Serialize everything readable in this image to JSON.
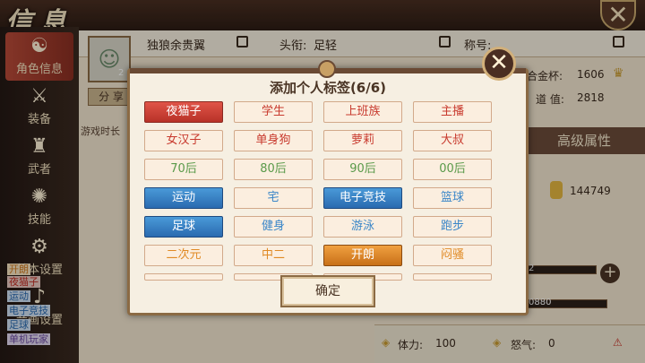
{
  "header": {
    "title": "信息",
    "close_icon": "close-icon"
  },
  "sidebar": {
    "items": [
      {
        "label": "角色信息",
        "icon": "character-icon"
      },
      {
        "label": "装备",
        "icon": "swords-icon"
      },
      {
        "label": "武者",
        "icon": "warrior-icon"
      },
      {
        "label": "技能",
        "icon": "skill-icon"
      },
      {
        "label": "基本设置",
        "icon": "gear-icon"
      },
      {
        "label": "音画设置",
        "icon": "sound-icon"
      }
    ]
  },
  "profile": {
    "name": "独狼余贵翼",
    "title_label": "头衔:",
    "title_value": "足轻",
    "nickname_label": "称号:",
    "level_fragment": "2",
    "share_label": "分 享",
    "playtime_label": "游戏时长",
    "cup_label": "合金杯:",
    "cup_value": "1606",
    "virtue_label": "道 值:",
    "virtue_value": "2818",
    "advanced_attr_label": "高级属性",
    "gold_value": "144749",
    "bar1_value": "2",
    "bar2_value": "0880",
    "stamina_label": "体力:",
    "stamina_value": "100",
    "rage_label": "怒气:",
    "rage_value": "0"
  },
  "left_tags": [
    "开朗",
    "夜猫子",
    "运动",
    "电子竞技",
    "足球",
    "单机玩家"
  ],
  "modal": {
    "title": "添加个人标签(6/6)",
    "confirm_label": "确定",
    "tags": [
      {
        "label": "夜猫子",
        "style": "selected-red"
      },
      {
        "label": "学生",
        "style": "red"
      },
      {
        "label": "上班族",
        "style": "red"
      },
      {
        "label": "主播",
        "style": "red"
      },
      {
        "label": "女汉子",
        "style": "red"
      },
      {
        "label": "单身狗",
        "style": "red"
      },
      {
        "label": "萝莉",
        "style": "red"
      },
      {
        "label": "大叔",
        "style": "red"
      },
      {
        "label": "70后",
        "style": "green"
      },
      {
        "label": "80后",
        "style": "green"
      },
      {
        "label": "90后",
        "style": "green"
      },
      {
        "label": "00后",
        "style": "green"
      },
      {
        "label": "运动",
        "style": "selected-blue"
      },
      {
        "label": "宅",
        "style": "blue"
      },
      {
        "label": "电子竞技",
        "style": "selected-blue"
      },
      {
        "label": "篮球",
        "style": "blue"
      },
      {
        "label": "足球",
        "style": "selected-blue"
      },
      {
        "label": "健身",
        "style": "blue"
      },
      {
        "label": "游泳",
        "style": "blue"
      },
      {
        "label": "跑步",
        "style": "blue"
      },
      {
        "label": "二次元",
        "style": "orange"
      },
      {
        "label": "中二",
        "style": "orange"
      },
      {
        "label": "开朗",
        "style": "selected-orange"
      },
      {
        "label": "闷骚",
        "style": "orange"
      }
    ]
  },
  "colors": {
    "selected_red": "#c83a2e",
    "selected_blue": "#2a6ab0",
    "selected_orange": "#d88020",
    "modal_border": "#8b6a44"
  }
}
